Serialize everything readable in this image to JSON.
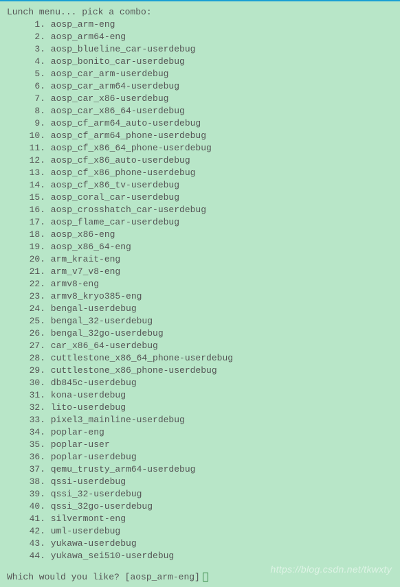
{
  "header": "Lunch menu... pick a combo:",
  "items": [
    "aosp_arm-eng",
    "aosp_arm64-eng",
    "aosp_blueline_car-userdebug",
    "aosp_bonito_car-userdebug",
    "aosp_car_arm-userdebug",
    "aosp_car_arm64-userdebug",
    "aosp_car_x86-userdebug",
    "aosp_car_x86_64-userdebug",
    "aosp_cf_arm64_auto-userdebug",
    "aosp_cf_arm64_phone-userdebug",
    "aosp_cf_x86_64_phone-userdebug",
    "aosp_cf_x86_auto-userdebug",
    "aosp_cf_x86_phone-userdebug",
    "aosp_cf_x86_tv-userdebug",
    "aosp_coral_car-userdebug",
    "aosp_crosshatch_car-userdebug",
    "aosp_flame_car-userdebug",
    "aosp_x86-eng",
    "aosp_x86_64-eng",
    "arm_krait-eng",
    "arm_v7_v8-eng",
    "armv8-eng",
    "armv8_kryo385-eng",
    "bengal-userdebug",
    "bengal_32-userdebug",
    "bengal_32go-userdebug",
    "car_x86_64-userdebug",
    "cuttlestone_x86_64_phone-userdebug",
    "cuttlestone_x86_phone-userdebug",
    "db845c-userdebug",
    "kona-userdebug",
    "lito-userdebug",
    "pixel3_mainline-userdebug",
    "poplar-eng",
    "poplar-user",
    "poplar-userdebug",
    "qemu_trusty_arm64-userdebug",
    "qssi-userdebug",
    "qssi_32-userdebug",
    "qssi_32go-userdebug",
    "silvermont-eng",
    "uml-userdebug",
    "yukawa-userdebug",
    "yukawa_sei510-userdebug"
  ],
  "prompt": {
    "question": "Which would you like? ",
    "default": "[aosp_arm-eng]"
  },
  "watermark": "https://blog.csdn.net/tkwxty"
}
